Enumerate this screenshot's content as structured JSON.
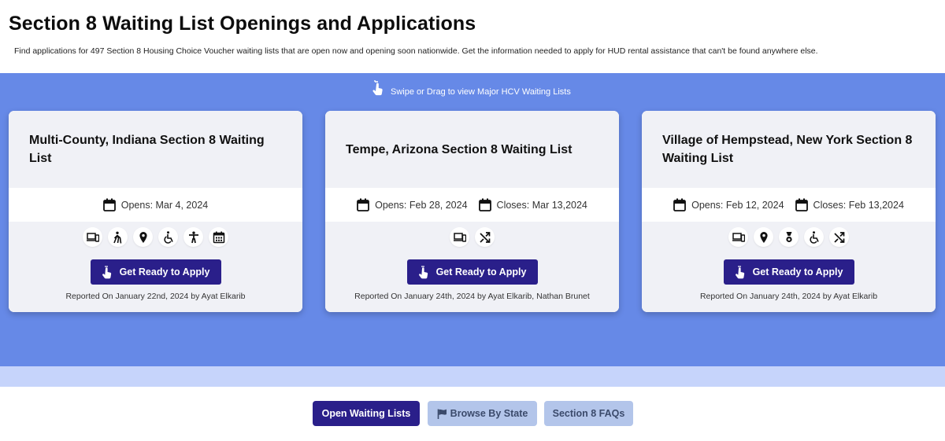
{
  "header": {
    "title": "Section 8 Waiting List Openings and Applications",
    "subtitle": "Find applications for 497 Section 8 Housing Choice Voucher waiting lists that are open now and opening soon nationwide. Get the information needed to apply for HUD rental assistance that can't be found anywhere else."
  },
  "carousel": {
    "hint": "Swipe or Drag to view Major HCV Waiting Lists",
    "cards": [
      {
        "title": "Multi-County, Indiana Section 8 Waiting List",
        "opens": "Opens: Mar 4, 2024",
        "closes": "",
        "feature_icons": [
          "devices-icon",
          "senior-icon",
          "location-pin-icon",
          "wheelchair-icon",
          "person-icon",
          "calendar-grid-icon"
        ],
        "button_label": "Get Ready to Apply",
        "reported": "Reported On January 22nd, 2024 by Ayat Elkarib"
      },
      {
        "title": "Tempe, Arizona Section 8 Waiting List",
        "opens": "Opens: Feb 28, 2024",
        "closes": "Closes: Mar 13,2024",
        "feature_icons": [
          "devices-icon",
          "shuffle-icon"
        ],
        "button_label": "Get Ready to Apply",
        "reported": "Reported On January 24th, 2024 by Ayat Elkarib, Nathan Brunet"
      },
      {
        "title": "Village of Hempstead, New York Section 8 Waiting List",
        "opens": "Opens: Feb 12, 2024",
        "closes": "Closes: Feb 13,2024",
        "feature_icons": [
          "devices-icon",
          "location-pin-icon",
          "veteran-medal-icon",
          "wheelchair-icon",
          "shuffle-icon"
        ],
        "button_label": "Get Ready to Apply",
        "reported": "Reported On January 24th, 2024 by Ayat Elkarib"
      }
    ]
  },
  "nav": {
    "open_lists": "Open Waiting Lists",
    "browse_state": "Browse By State",
    "faqs": "Section 8 FAQs"
  },
  "colors": {
    "band": "#6689e7",
    "light_band": "#c6d4fb",
    "primary_button": "#2a1f8a",
    "secondary_button": "#b3c5ea",
    "card_panel": "#f0f1f6"
  }
}
